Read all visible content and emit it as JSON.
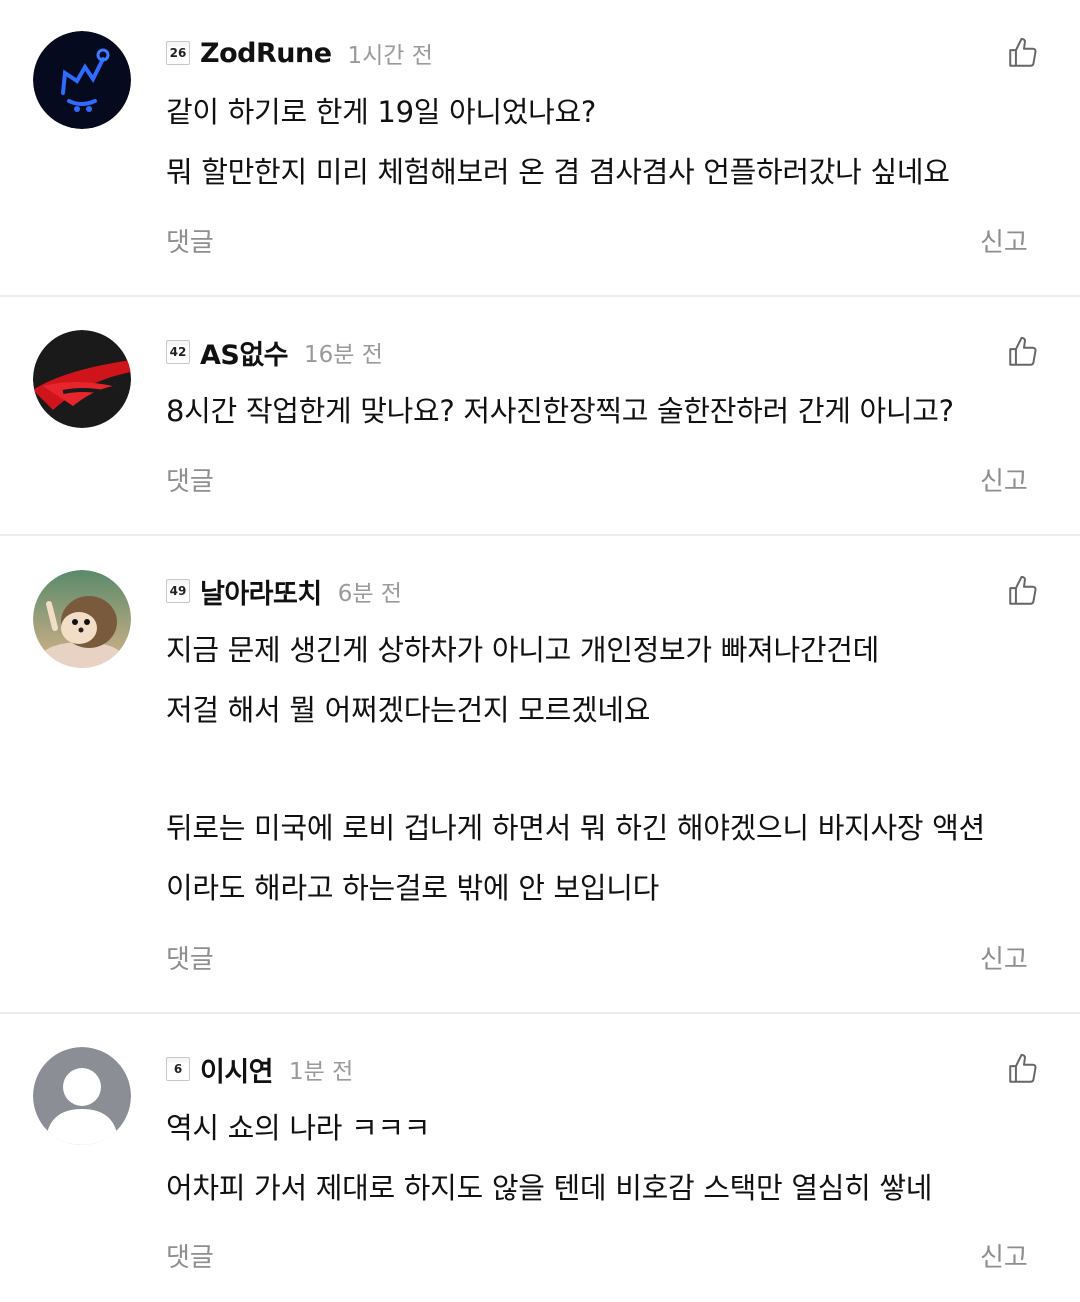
{
  "comments": [
    {
      "level": "26",
      "username": "ZodRune",
      "time": "1시간 전",
      "lines": [
        "같이 하기로 한게 19일 아니었나요?",
        "뭐 할만한지 미리 체험해보러 온 겸 겸사겸사 언플하러갔나 싶네요"
      ],
      "reply_label": "댓글",
      "report_label": "신고",
      "like_icon": "thumbs-up-icon",
      "avatar": "neon-crown-avatar"
    },
    {
      "level": "42",
      "username": "AS없수",
      "time": "16분 전",
      "lines": [
        "8시간 작업한게 맞나요? 저사진한장찍고 술한잔하러 간게 아니고?"
      ],
      "reply_label": "댓글",
      "report_label": "신고",
      "like_icon": "thumbs-up-icon",
      "avatar": "red-logo-avatar"
    },
    {
      "level": "49",
      "username": "날아라또치",
      "time": "6분 전",
      "lines": [
        "지금 문제 생긴게 상하차가 아니고 개인정보가 빠져나간건데",
        "저걸 해서 뭘 어쩌겠다는건지 모르겠네요",
        "",
        "뒤로는 미국에 로비 겁나게 하면서 뭐 하긴 해야겠으니 바지사장 액션",
        "이라도 해라고 하는걸로 밖에 안 보입니다"
      ],
      "reply_label": "댓글",
      "report_label": "신고",
      "like_icon": "thumbs-up-icon",
      "avatar": "hedgehog-avatar"
    },
    {
      "level": "6",
      "username": "이시연",
      "time": "1분 전",
      "lines": [
        "역시 쇼의 나라 ㅋㅋㅋ",
        "어차피 가서 제대로 하지도 않을 텐데 비호감 스택만 열심히 쌓네"
      ],
      "reply_label": "댓글",
      "report_label": "신고",
      "like_icon": "thumbs-up-icon",
      "avatar": "default-user-avatar"
    }
  ]
}
